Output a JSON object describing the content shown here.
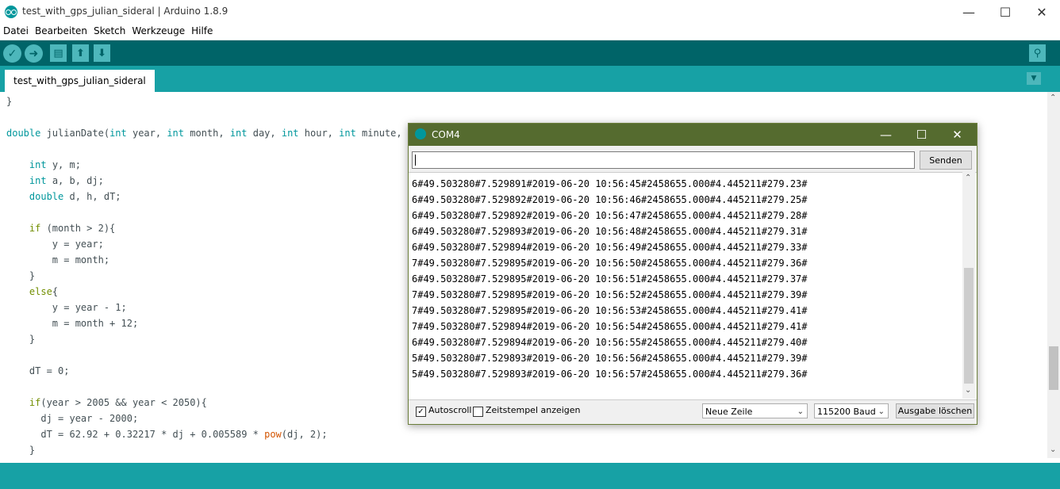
{
  "window": {
    "title": "test_with_gps_julian_sideral | Arduino 1.8.9",
    "minimize": "—",
    "maximize": "☐",
    "close": "✕"
  },
  "menu": [
    "Datei",
    "Bearbeiten",
    "Sketch",
    "Werkzeuge",
    "Hilfe"
  ],
  "toolbar": {
    "verify_icon": "✓",
    "upload_icon": "➜",
    "new_icon": "▤",
    "open_icon": "⬆",
    "save_icon": "⬇",
    "serial_icon": "⚲"
  },
  "tabs": {
    "active": "test_with_gps_julian_sideral",
    "menu_icon": "▼"
  },
  "code": [
    [
      {
        "t": "}"
      }
    ],
    [],
    [
      {
        "t": "double",
        "c": "kw"
      },
      {
        "t": " julianDate("
      },
      {
        "t": "int",
        "c": "kw"
      },
      {
        "t": " year, "
      },
      {
        "t": "int",
        "c": "kw"
      },
      {
        "t": " month, "
      },
      {
        "t": "int",
        "c": "kw"
      },
      {
        "t": " day, "
      },
      {
        "t": "int",
        "c": "kw"
      },
      {
        "t": " hour, "
      },
      {
        "t": "int",
        "c": "kw"
      },
      {
        "t": " minute, "
      }
    ],
    [],
    [
      {
        "t": "    "
      },
      {
        "t": "int",
        "c": "kw"
      },
      {
        "t": " y, m;"
      }
    ],
    [
      {
        "t": "    "
      },
      {
        "t": "int",
        "c": "kw"
      },
      {
        "t": " a, b, dj;"
      }
    ],
    [
      {
        "t": "    "
      },
      {
        "t": "double",
        "c": "kw"
      },
      {
        "t": " d, h, dT;"
      }
    ],
    [],
    [
      {
        "t": "    "
      },
      {
        "t": "if",
        "c": "kw2"
      },
      {
        "t": " (month > 2){"
      }
    ],
    [
      {
        "t": "        y = year;"
      }
    ],
    [
      {
        "t": "        m = month;"
      }
    ],
    [
      {
        "t": "    }"
      }
    ],
    [
      {
        "t": "    "
      },
      {
        "t": "else",
        "c": "kw2"
      },
      {
        "t": "{"
      }
    ],
    [
      {
        "t": "        y = year - 1;"
      }
    ],
    [
      {
        "t": "        m = month + 12;"
      }
    ],
    [
      {
        "t": "    }"
      }
    ],
    [],
    [
      {
        "t": "    dT = 0;"
      }
    ],
    [],
    [
      {
        "t": "    "
      },
      {
        "t": "if",
        "c": "kw2"
      },
      {
        "t": "(year > 2005 && year < 2050){"
      }
    ],
    [
      {
        "t": "      dj = year - 2000;"
      }
    ],
    [
      {
        "t": "      dT = 62.92 + 0.32217 * dj + 0.005589 * "
      },
      {
        "t": "pow",
        "c": "fn"
      },
      {
        "t": "(dj, 2);"
      }
    ],
    [
      {
        "t": "    }"
      }
    ]
  ],
  "serial": {
    "title": "COM4",
    "minimize": "—",
    "maximize": "☐",
    "close": "✕",
    "input_value": "",
    "send_label": "Senden",
    "output": [
      "6#49.503280#7.529891#2019-06-20 10:56:45#2458655.000#4.445211#279.23#",
      "6#49.503280#7.529892#2019-06-20 10:56:46#2458655.000#4.445211#279.25#",
      "6#49.503280#7.529892#2019-06-20 10:56:47#2458655.000#4.445211#279.28#",
      "6#49.503280#7.529893#2019-06-20 10:56:48#2458655.000#4.445211#279.31#",
      "6#49.503280#7.529894#2019-06-20 10:56:49#2458655.000#4.445211#279.33#",
      "7#49.503280#7.529895#2019-06-20 10:56:50#2458655.000#4.445211#279.36#",
      "6#49.503280#7.529895#2019-06-20 10:56:51#2458655.000#4.445211#279.37#",
      "7#49.503280#7.529895#2019-06-20 10:56:52#2458655.000#4.445211#279.39#",
      "7#49.503280#7.529895#2019-06-20 10:56:53#2458655.000#4.445211#279.41#",
      "7#49.503280#7.529894#2019-06-20 10:56:54#2458655.000#4.445211#279.41#",
      "6#49.503280#7.529894#2019-06-20 10:56:55#2458655.000#4.445211#279.40#",
      "5#49.503280#7.529893#2019-06-20 10:56:56#2458655.000#4.445211#279.39#",
      "5#49.503280#7.529893#2019-06-20 10:56:57#2458655.000#4.445211#279.36#"
    ],
    "autoscroll_label": "Autoscroll",
    "autoscroll_checked": "✓",
    "timestamp_label": "Zeitstempel anzeigen",
    "line_ending": "Neue Zeile",
    "baud": "115200 Baud",
    "clear_label": "Ausgabe löschen",
    "scroll_up": "⌃",
    "scroll_down": "⌄",
    "dropdown_arrow": "⌄"
  },
  "editor_scroll": {
    "up": "⌃",
    "down": "⌄"
  },
  "colors": {
    "toolbar": "#006468",
    "tabbar": "#17a1a5",
    "serial_titlebar": "#556b2f",
    "keyword": "#00979c",
    "control": "#728e00",
    "function": "#d35400"
  }
}
